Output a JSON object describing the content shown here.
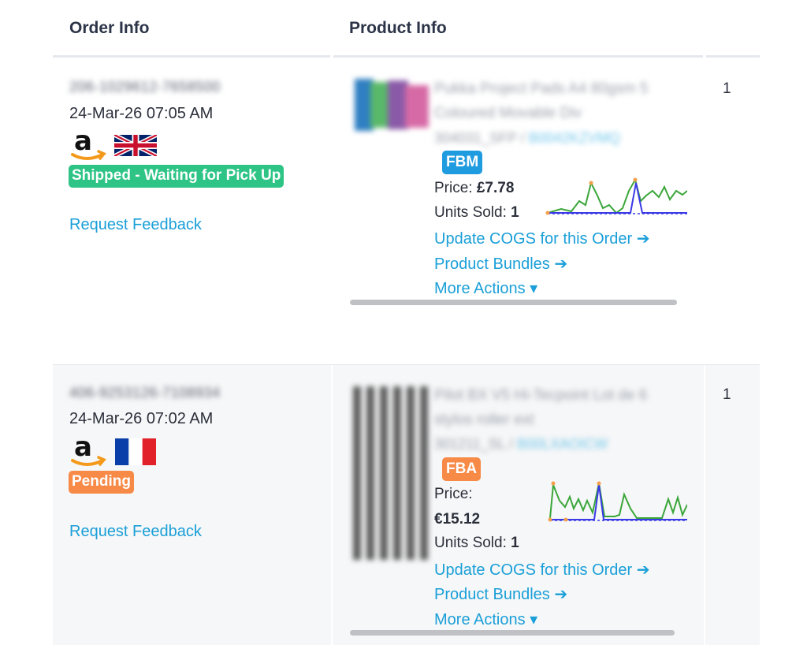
{
  "headers": {
    "order_info": "Order Info",
    "product_info": "Product Info"
  },
  "orders": [
    {
      "order_id": "206-1029612-7658500",
      "date": "24-Mar-26 07:05 AM",
      "marketplace_flag": "uk-flag-icon",
      "status": "Shipped - Waiting for Pick Up",
      "status_color": "#2ec486",
      "request_feedback": "Request Feedback",
      "product": {
        "title_line1": "Pukka Project Pads A4 80gsm 5",
        "title_line2": "Coloured Movable Div",
        "sku": "304031_SFP",
        "asin": "B0042KZVMQ",
        "fulfillment": "FBM",
        "price_label": "Price:",
        "price": "£7.78",
        "units_label": "Units Sold:",
        "units": "1",
        "update_cogs": "Update COGS for this Order ➔",
        "bundles": "Product Bundles ➔",
        "more_actions": "More Actions ▾"
      },
      "qty": "1"
    },
    {
      "order_id": "406-9253126-7108934",
      "date": "24-Mar-26 07:02 AM",
      "marketplace_flag": "france-flag-icon",
      "status": "Pending",
      "status_color": "#f78a47",
      "request_feedback": "Request Feedback",
      "product": {
        "title_line1": "Pilot BX V5 Hi-Tecpoint Lot de 6",
        "title_line2": "stylos roller ext",
        "sku": "301211_SL",
        "asin": "B00LXAOICW",
        "fulfillment": "FBA",
        "price_label": "Price:",
        "price": "€15.12",
        "units_label": "Units Sold:",
        "units": "1",
        "update_cogs": "Update COGS for this Order ➔",
        "bundles": "Product Bundles ➔",
        "more_actions": "More Actions ▾"
      },
      "qty": "1"
    }
  ],
  "colors": {
    "link": "#1a9fd8",
    "sparkline_green": "#3aa63a",
    "sparkline_blue": "#3a3ae6",
    "sparkline_dot": "#f5a04a"
  }
}
